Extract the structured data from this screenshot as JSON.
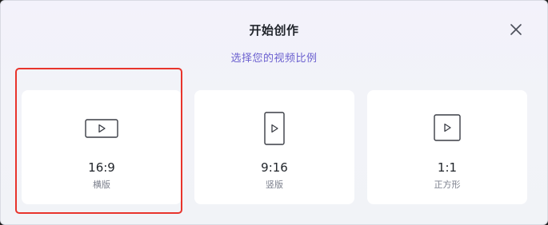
{
  "dialog": {
    "title": "开始创作",
    "subtitle": "选择您的视频比例",
    "close_icon": "close-icon"
  },
  "options": [
    {
      "ratio": "16:9",
      "label": "横版",
      "icon": "play-landscape-icon"
    },
    {
      "ratio": "9:16",
      "label": "竖版",
      "icon": "play-portrait-icon"
    },
    {
      "ratio": "1:1",
      "label": "正方形",
      "icon": "play-square-icon"
    }
  ],
  "selected_index": 0,
  "colors": {
    "highlight": "#e8342c",
    "subtitle": "#6a5fcf",
    "card": "#ffffff"
  }
}
